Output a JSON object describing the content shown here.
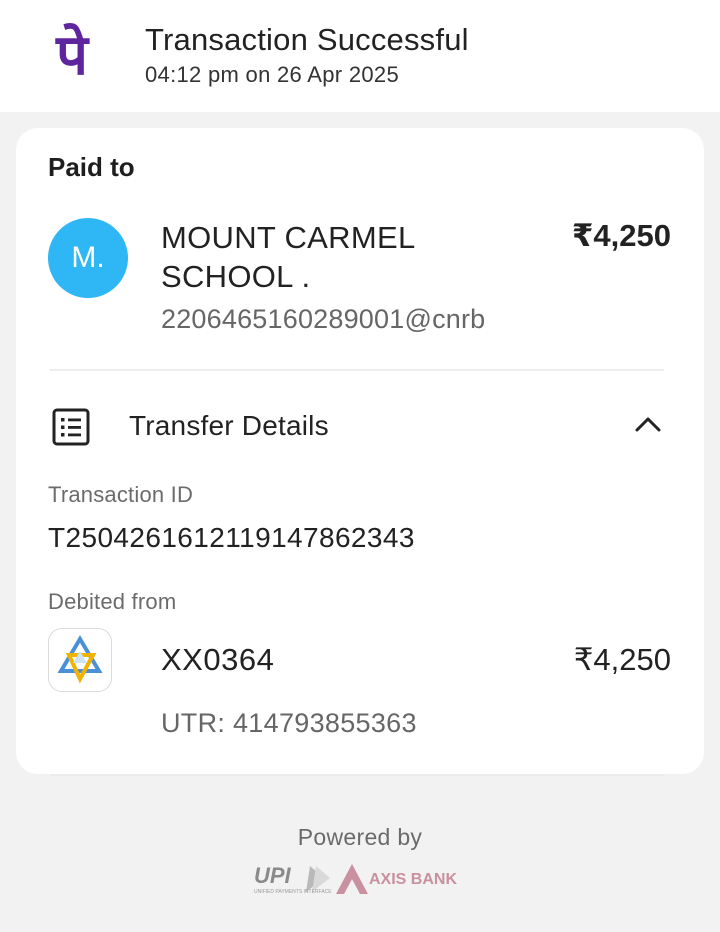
{
  "header": {
    "title": "Transaction Successful",
    "timestamp": "04:12 pm on 26 Apr 2025",
    "logo_icon": "phonepe-logo-icon",
    "brand_color": "#5f259f"
  },
  "paid_to": {
    "heading": "Paid to",
    "avatar_initial": "M.",
    "avatar_color": "#2eb6f5",
    "name": "MOUNT CARMEL SCHOOL .",
    "upi_id": "220646516028900​1@cnrb",
    "amount": "₹4,250"
  },
  "transfer_details": {
    "label": "Transfer Details",
    "icon": "receipt-list-icon",
    "expanded": true,
    "transaction_id_label": "Transaction ID",
    "transaction_id": "T2504261612119147862343",
    "debited_from_label": "Debited from",
    "bank_icon": "bank-logo-icon",
    "account": "XX0364",
    "account_amount": "₹4,250",
    "utr": "UTR: 414793855363"
  },
  "footer": {
    "powered_by": "Powered by",
    "upi_logo": "UPI",
    "upi_tagline": "UNIFIED PAYMENTS INTERFACE",
    "bank_logo": "AXIS BANK"
  }
}
